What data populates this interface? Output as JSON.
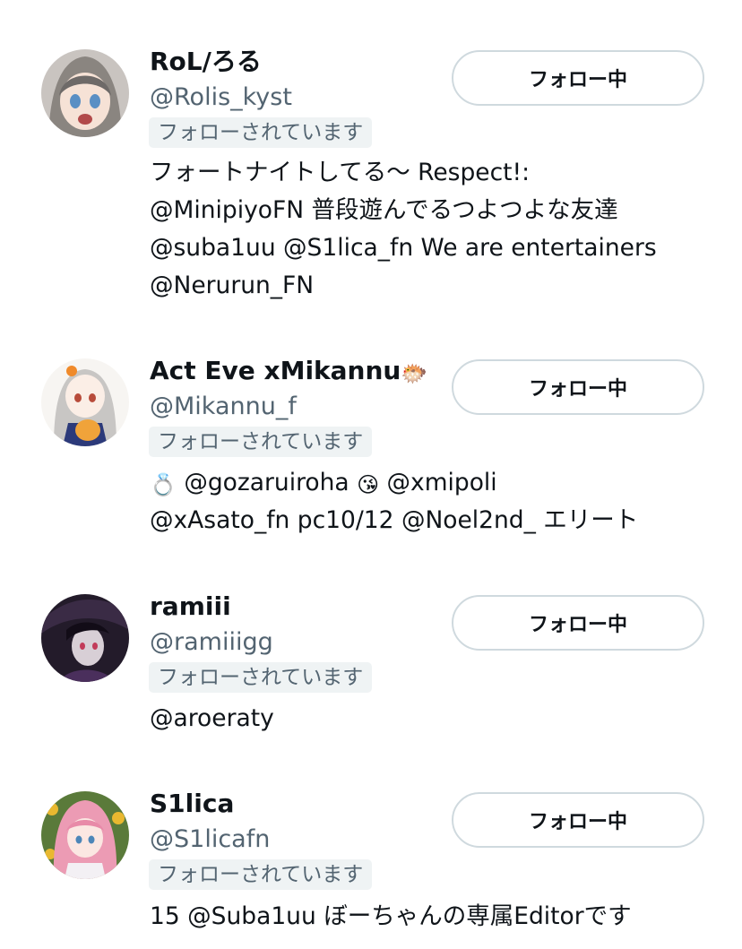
{
  "users": [
    {
      "display_name": "RoL/ろる",
      "handle": "@Rolis_kyst",
      "follows_you_label": "フォローされています",
      "button_label": "フォロー中",
      "bio_lines": [
        "フォートナイトしてる〜 Respect!:",
        "@MinipiyoFN 普段遊んでるつよつよな友達",
        "@suba1uu @S1lica_fn We are entertainers",
        "@Nerurun_FN"
      ]
    },
    {
      "display_name": "Act Eve xMikannu",
      "name_emoji": "🐡",
      "handle": "@Mikannu_f",
      "follows_you_label": "フォローされています",
      "button_label": "フォロー中",
      "bio_line1_emoji_a": "💍",
      "bio_line1_text_a": "@gozaruiroha",
      "bio_line1_emoji_b": "😘",
      "bio_line1_text_b": "@xmipoli",
      "bio_lines": [
        "@xAsato_fn pc10/12 @Noel2nd_ エリート"
      ]
    },
    {
      "display_name": "ramiii",
      "handle": "@ramiiigg",
      "follows_you_label": "フォローされています",
      "button_label": "フォロー中",
      "bio_lines": [
        "@aroeraty"
      ]
    },
    {
      "display_name": "S1lica",
      "handle": "@S1licafn",
      "follows_you_label": "フォローされています",
      "button_label": "フォロー中",
      "bio_lines": [
        "15 @Suba1uu ぼーちゃんの専属Editorです"
      ]
    }
  ],
  "colors": {
    "text_primary": "#0f1419",
    "text_secondary": "#536471",
    "badge_bg": "#eff3f4",
    "button_border": "#cfd9de"
  }
}
